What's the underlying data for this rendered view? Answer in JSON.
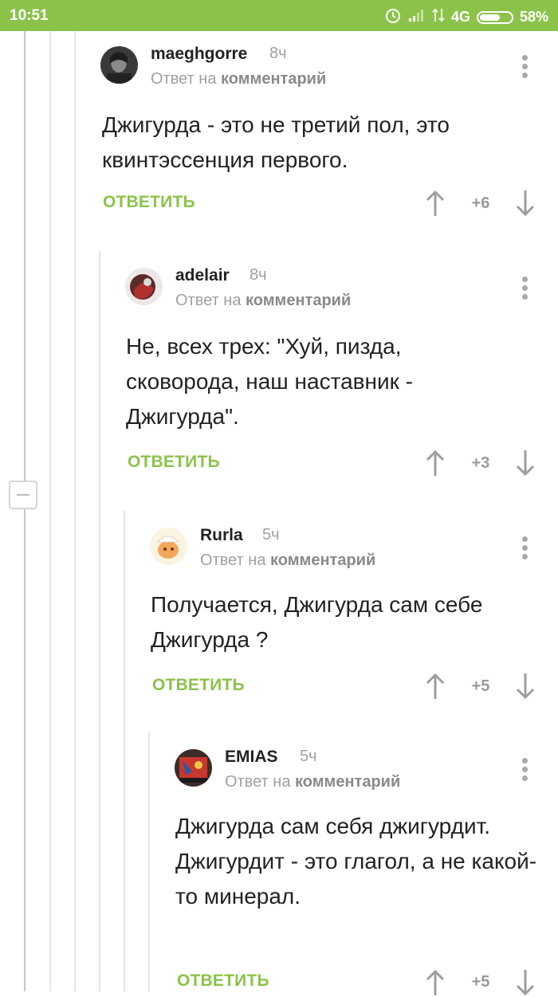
{
  "status_bar": {
    "time": "10:51",
    "network": "4G",
    "battery": "58%"
  },
  "reply_label": "Ответ на",
  "reply_target": "комментарий",
  "reply_button": "ОТВЕТИТЬ",
  "comments": [
    {
      "author": "maeghgorre",
      "ago": "8ч",
      "text": "Джигурда - это не третий пол, это квинтэссенция первого.",
      "rating": "+6"
    },
    {
      "author": "adelair",
      "ago": "8ч",
      "text": "Не, всех трех: \"Хуй, пизда, сковорода, наш наставник - Джигурда\".",
      "rating": "+3"
    },
    {
      "author": "Rurla",
      "ago": "5ч",
      "text": "Получается, Джигурда сам себе Джигурда ?",
      "rating": "+5"
    },
    {
      "author": "EMIAS",
      "ago": "5ч",
      "text": "Джигурда сам себя джигурдит.\nДжигурдит - это глагол, а не какой-то минерал.",
      "rating": "+5"
    }
  ],
  "colors": {
    "accent": "#8bc34a"
  }
}
